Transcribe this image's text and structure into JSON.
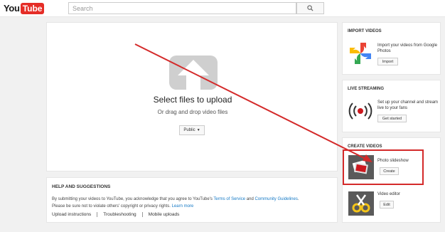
{
  "header": {
    "logo_you": "You",
    "logo_tube": "Tube",
    "search_placeholder": "Search"
  },
  "upload": {
    "title": "Select files to upload",
    "subtitle": "Or drag and drop video files",
    "privacy": "Public"
  },
  "help": {
    "title": "HELP AND SUGGESTIONS",
    "text_before_tos": "By submitting your videos to YouTube, you acknowledge that you agree to YouTube's ",
    "tos_link": "Terms of Service",
    "text_and": " and ",
    "guidelines_link": "Community Guidelines",
    "text_after": ".",
    "line2": "Please be sure not to violate others' copyright or privacy rights. ",
    "learn_more": "Learn more",
    "links": [
      "Upload instructions",
      "Troubleshooting",
      "Mobile uploads"
    ]
  },
  "import_videos": {
    "title": "IMPORT VIDEOS",
    "text": "Import your videos from Google Photos",
    "button": "Import"
  },
  "live_streaming": {
    "title": "LIVE STREAMING",
    "text": "Set up your channel and stream live to your fans",
    "button": "Get started"
  },
  "create_videos": {
    "title": "CREATE VIDEOS",
    "slideshow_label": "Photo slideshow",
    "slideshow_button": "Create",
    "editor_label": "Video editor",
    "editor_button": "Edit"
  },
  "colors": {
    "brand_red": "#e52d27",
    "annotation_red": "#d42a2a",
    "link_blue": "#167ac6"
  }
}
